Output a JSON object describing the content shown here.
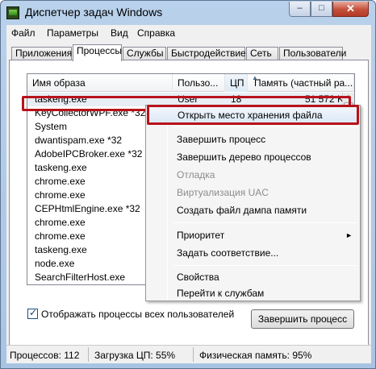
{
  "window": {
    "title": "Диспетчер задач Windows",
    "min_glyph": "–",
    "max_glyph": "□",
    "close_glyph": "✕"
  },
  "menu": [
    "Файл",
    "Параметры",
    "Вид",
    "Справка"
  ],
  "tabs": [
    "Приложения",
    "Процессы",
    "Службы",
    "Быстродействие",
    "Сеть",
    "Пользователи"
  ],
  "active_tab": "Процессы",
  "columns": {
    "image": "Имя образа",
    "user": "Пользо...",
    "cpu": "ЦП",
    "memory": "Память (частный ра..."
  },
  "processes": [
    {
      "name": "taskeng.exe",
      "user": "User",
      "cpu": "18",
      "memory": "51 572 K"
    },
    {
      "name": "KeyCollectorWPF.exe *32"
    },
    {
      "name": "System"
    },
    {
      "name": "dwantispam.exe *32"
    },
    {
      "name": "AdobeIPCBroker.exe *32"
    },
    {
      "name": "taskeng.exe"
    },
    {
      "name": "chrome.exe"
    },
    {
      "name": "chrome.exe"
    },
    {
      "name": "CEPHtmlEngine.exe *32"
    },
    {
      "name": "chrome.exe"
    },
    {
      "name": "chrome.exe"
    },
    {
      "name": "taskeng.exe"
    },
    {
      "name": "node.exe"
    },
    {
      "name": "SearchFilterHost.exe"
    }
  ],
  "context_menu": {
    "open_location": "Открыть место хранения файла",
    "end_process": "Завершить процесс",
    "end_tree": "Завершить дерево процессов",
    "debug": "Отладка",
    "uac": "Виртуализация UAC",
    "dump": "Создать файл дампа памяти",
    "priority": "Приоритет",
    "affinity": "Задать соответствие...",
    "properties": "Свойства",
    "services": "Перейти к службам",
    "submenu_arrow": "►"
  },
  "show_all": {
    "label": "Отображать процессы всех пользователей",
    "checked": true
  },
  "end_button": "Завершить процесс",
  "status": {
    "processes": "Процессов: 112",
    "cpu": "Загрузка ЦП: 55%",
    "memory": "Физическая память: 95%"
  }
}
